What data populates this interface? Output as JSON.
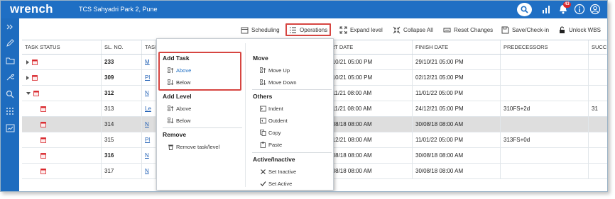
{
  "app": {
    "logo": "wrench",
    "project": "TCS Sahyadri Park 2, Pune",
    "notification_count": "43"
  },
  "colors": {
    "topbar": "#1f6fc4",
    "sidebar": "#1e6cbf",
    "highlight": "#d64541",
    "link": "#1f5fb5",
    "task_icon": "#d9262b",
    "selected_row": "#dedede"
  },
  "toolbar": {
    "scheduling": "Scheduling",
    "operations": "Operations",
    "expand": "Expand level",
    "collapse": "Collapse All",
    "reset": "Reset Changes",
    "save": "Save/Check-in",
    "unlock": "Unlock WBS"
  },
  "grid": {
    "headers": [
      "TASK STATUS",
      "SL. NO.",
      "TASK",
      "",
      "ART DATE",
      "FINISH DATE",
      "PREDECESSORS",
      "SUCC"
    ],
    "rows": [
      {
        "expander": "right",
        "sl": "233",
        "sl_bold": true,
        "task": "M",
        "start": "9/10/21 05:00 PM",
        "finish": "29/10/21 05:00 PM",
        "pred": "",
        "succ": ""
      },
      {
        "expander": "right",
        "sl": "309",
        "sl_bold": true,
        "task": "Pl",
        "start": "9/10/21 05:00 PM",
        "finish": "02/12/21 05:00 PM",
        "pred": "",
        "succ": ""
      },
      {
        "expander": "down",
        "sl": "312",
        "sl_bold": true,
        "task": "N",
        "start": "9/11/21 08:00 AM",
        "finish": "11/01/22 05:00 PM",
        "pred": "",
        "succ": ""
      },
      {
        "expander": "none",
        "sl": "313",
        "sl_bold": false,
        "task": "Le",
        "start": "9/11/21 08:00 AM",
        "finish": "24/12/21 05:00 PM",
        "pred": "310FS+2d",
        "succ": "31"
      },
      {
        "expander": "none",
        "sl": "314",
        "sl_bold": false,
        "task": "N",
        "start": "9/08/18 08:00 AM",
        "finish": "30/08/18 08:00 AM",
        "pred": "",
        "succ": "",
        "selected": true
      },
      {
        "expander": "none",
        "sl": "315",
        "sl_bold": false,
        "task": "Pl",
        "start": "9/12/21 08:00 AM",
        "finish": "11/01/22 05:00 PM",
        "pred": "313FS+0d",
        "succ": ""
      },
      {
        "expander": "none",
        "sl": "316",
        "sl_bold": true,
        "task": "N",
        "start": "9/08/18 08:00 AM",
        "finish": "30/08/18 08:00 AM",
        "pred": "",
        "succ": ""
      },
      {
        "expander": "none",
        "sl": "317",
        "sl_bold": false,
        "task": "N",
        "start": "9/08/18 08:00 AM",
        "finish": "30/08/18 08:00 AM",
        "pred": "",
        "succ": ""
      }
    ]
  },
  "menu": {
    "add_task": {
      "title": "Add Task",
      "above": "Above",
      "below": "Below"
    },
    "add_level": {
      "title": "Add Level",
      "above": "Above",
      "below": "Below"
    },
    "remove": {
      "title": "Remove",
      "item": "Remove task/level"
    },
    "move": {
      "title": "Move",
      "up": "Move Up",
      "down": "Move Down"
    },
    "others": {
      "title": "Others",
      "indent": "Indent",
      "outdent": "Outdent",
      "copy": "Copy",
      "paste": "Paste"
    },
    "active": {
      "title": "Active/Inactive",
      "inactive": "Set Inactive",
      "active": "Set Active"
    }
  }
}
